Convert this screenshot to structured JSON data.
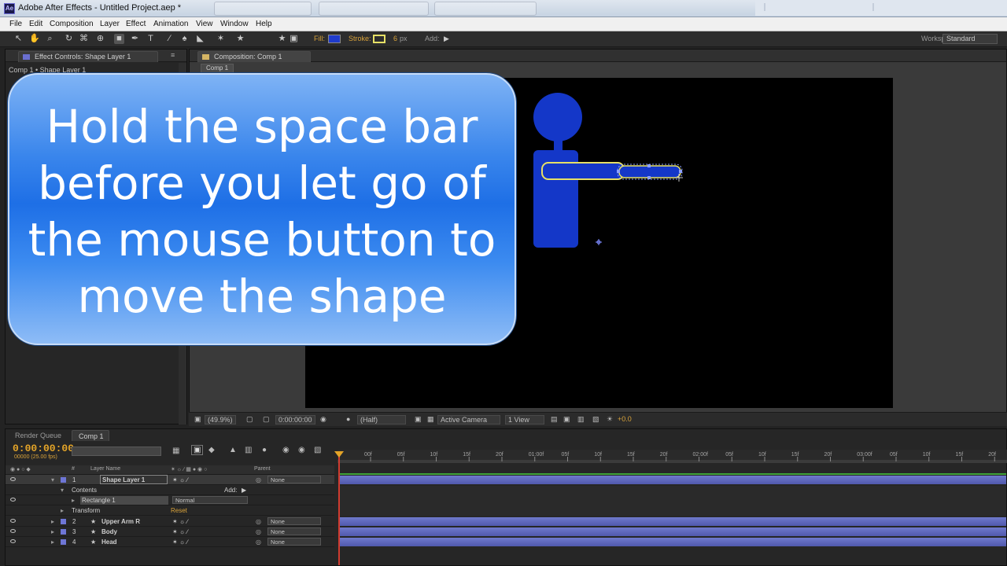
{
  "window": {
    "title": "Adobe After Effects - Untitled Project.aep *",
    "logo": "Ae"
  },
  "menu": [
    "File",
    "Edit",
    "Composition",
    "Layer",
    "Effect",
    "Animation",
    "View",
    "Window",
    "Help"
  ],
  "toolbar": {
    "fill_label": "Fill:",
    "stroke_label": "Stroke:",
    "stroke_width": "6",
    "stroke_unit": "px",
    "add_label": "Add:",
    "workspace_label": "Workspace:",
    "workspace_value": "Standard",
    "fill_color": "#1f3bcc",
    "stroke_color": "#e6e066"
  },
  "effect_controls": {
    "tab_label": "Effect Controls: Shape Layer 1",
    "breadcrumb": "Comp 1 • Shape Layer 1"
  },
  "composition": {
    "tab_label": "Composition: Comp 1",
    "sub_tab": "Comp 1",
    "shape_color": "#1437c8",
    "stroke_color": "#e6e066"
  },
  "viewer_bar": {
    "zoom": "(49.9%)",
    "timecode": "0:00:00:00",
    "resolution": "(Half)",
    "camera": "Active Camera",
    "views": "1 View",
    "exposure": "+0.0"
  },
  "callout": {
    "lines": [
      "Hold the space bar",
      "before you let go of",
      "the mouse button to",
      "move the shape"
    ]
  },
  "timeline": {
    "tabs": [
      "Render Queue",
      "Comp 1"
    ],
    "timecode": "0:00:00:00",
    "fps": "00000 (25.00 fps)",
    "headers": {
      "num": "#",
      "layer_name": "Layer Name",
      "parent": "Parent"
    },
    "layers": [
      {
        "num": "1",
        "name": "Shape Layer 1",
        "parent": "None"
      },
      {
        "num": "2",
        "name": "Upper Arm R",
        "parent": "None"
      },
      {
        "num": "3",
        "name": "Body",
        "parent": "None"
      },
      {
        "num": "4",
        "name": "Head",
        "parent": "None"
      }
    ],
    "contents_label": "Contents",
    "add_label": "Add:",
    "rectangle_label": "Rectangle 1",
    "blend_mode": "Normal",
    "transform_label": "Transform",
    "reset_label": "Reset",
    "ruler": [
      "00f",
      "05f",
      "10f",
      "15f",
      "20f",
      "01:00f",
      "05f",
      "10f",
      "15f",
      "20f",
      "02:00f",
      "05f",
      "10f",
      "15f",
      "20f",
      "03:00f",
      "05f",
      "10f",
      "15f",
      "20f",
      "04:00f"
    ]
  }
}
